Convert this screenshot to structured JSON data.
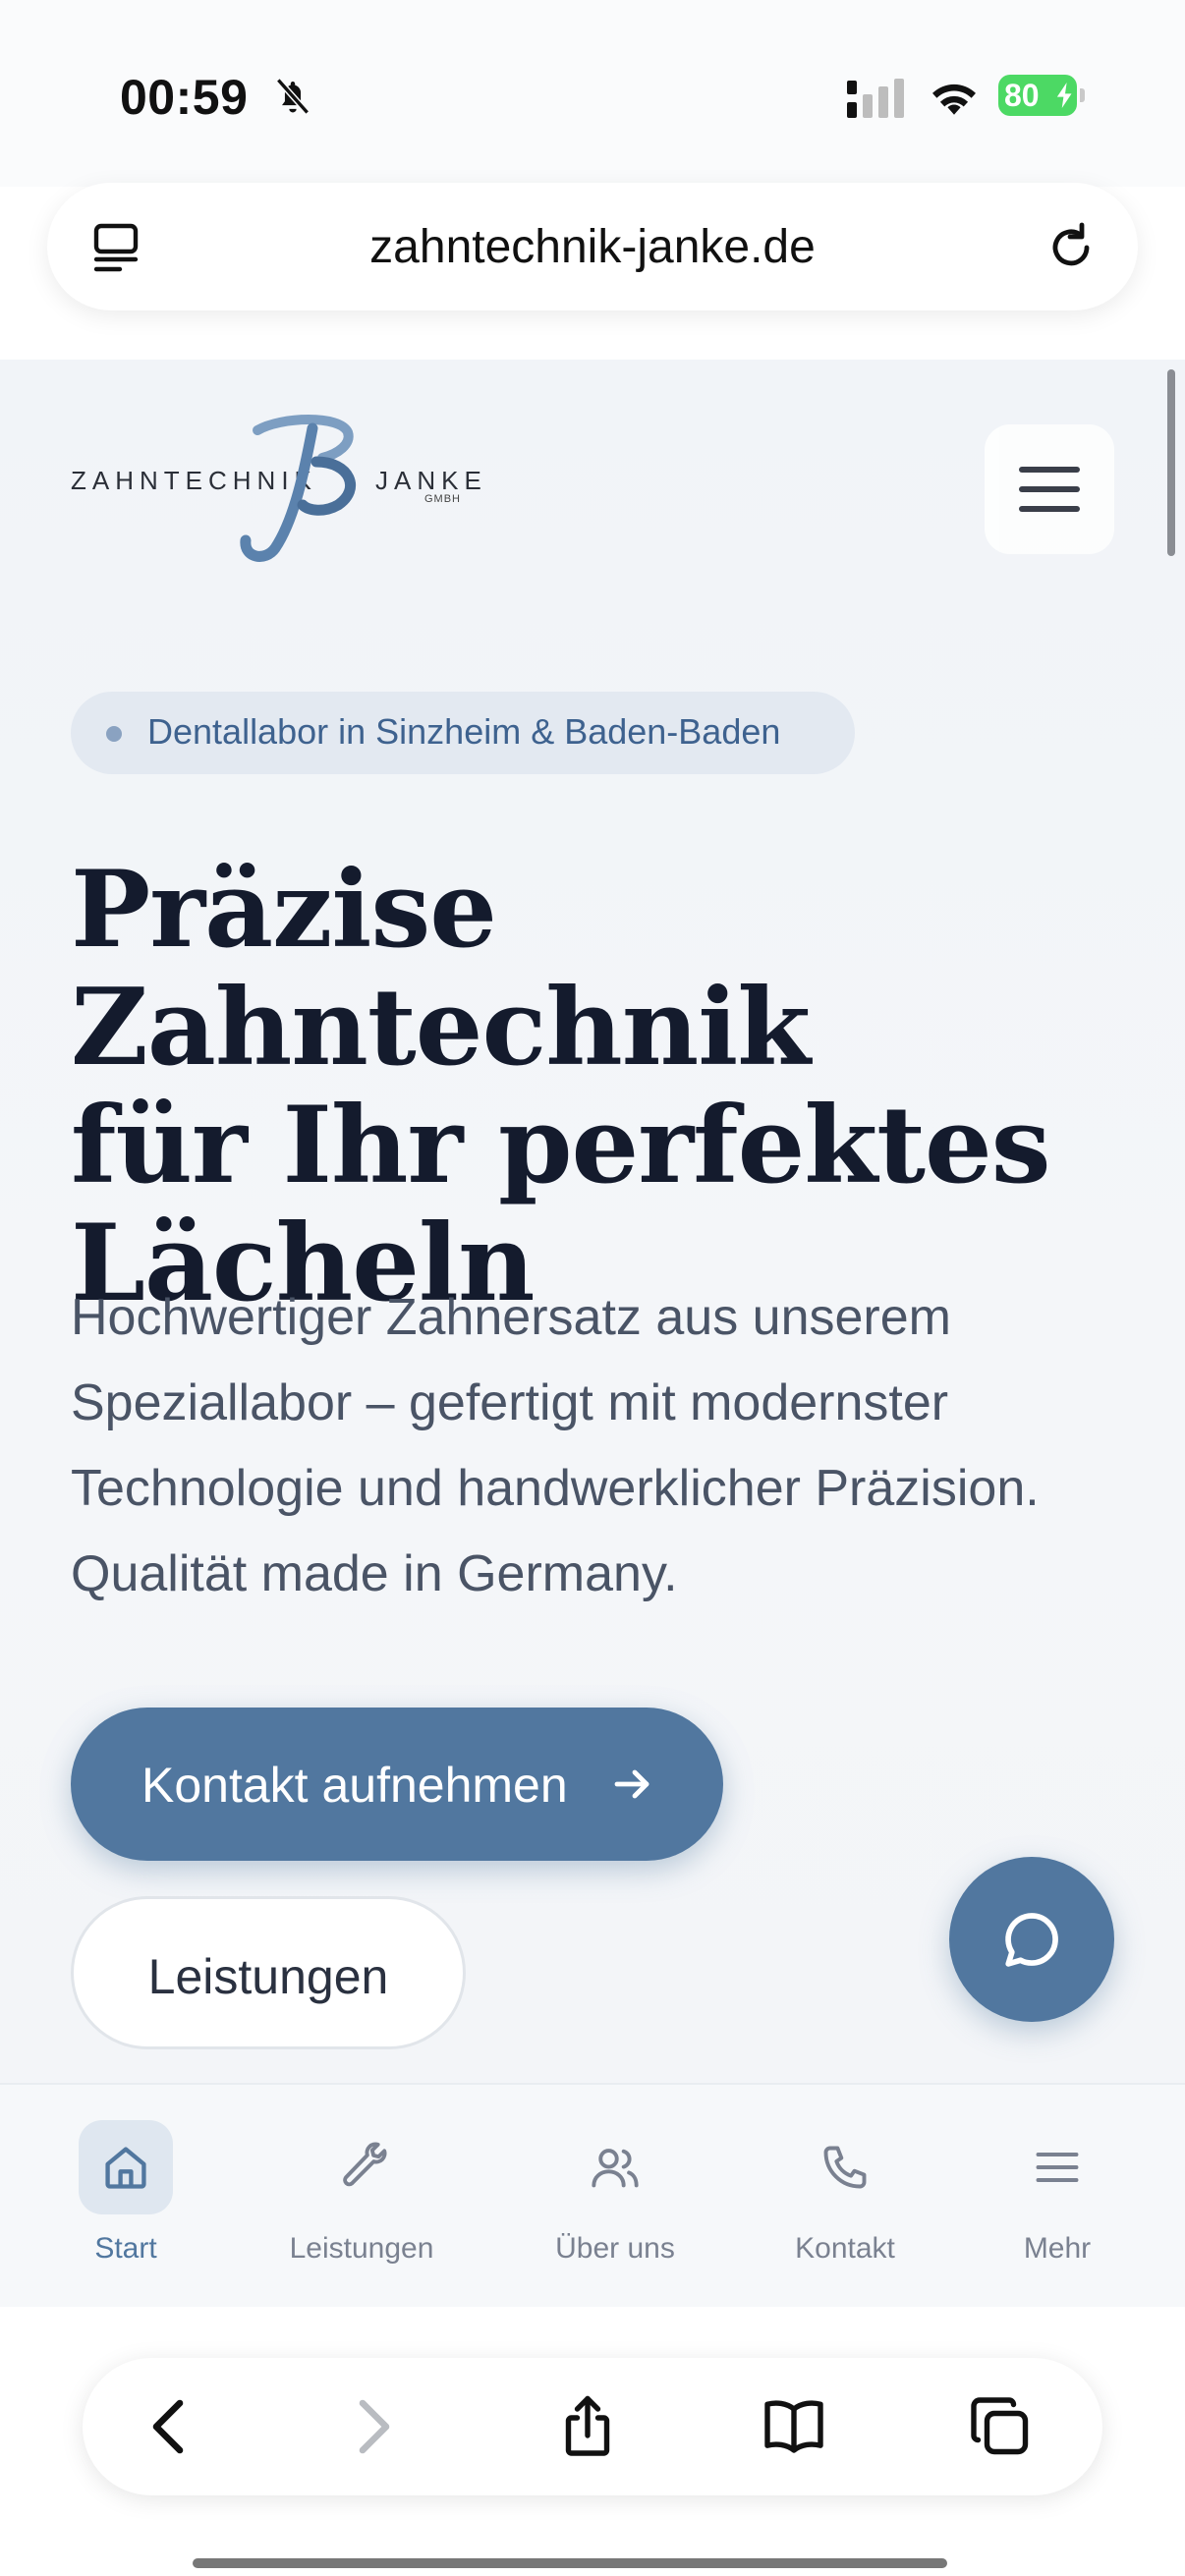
{
  "status_bar": {
    "time": "00:59",
    "battery": "80",
    "icons": [
      "bell-slash-icon",
      "cellular-signal-icon",
      "wifi-icon",
      "battery-charging-icon"
    ]
  },
  "browser": {
    "url": "zahntechnik-janke.de",
    "tabs_icon": "tab-overview-icon",
    "reload_icon": "reload-icon"
  },
  "header": {
    "logo": {
      "left_text": "ZAHNTECHNIK",
      "right_text": "JANKE",
      "suffix": "GMBH"
    },
    "menu_icon": "hamburger-icon"
  },
  "hero": {
    "badge": "Dentallabor in Sinzheim & Baden-Baden",
    "title_line1": "Präzise Zahntechnik",
    "title_line2": "für Ihr perfektes",
    "title_line3": "Lächeln",
    "description": "Hochwertiger Zahnersatz aus unserem Speziallabor – gefertigt mit modernster Technologie und handwerklicher Präzision. Qualität made in Germany.",
    "primary_button": "Kontakt aufnehmen",
    "secondary_button": "Leistungen"
  },
  "chat": {
    "icon": "chat-bubble-icon"
  },
  "bottom_nav": {
    "items": [
      {
        "label": "Start",
        "icon": "home-icon",
        "active": true
      },
      {
        "label": "Leistungen",
        "icon": "wrench-icon",
        "active": false
      },
      {
        "label": "Über uns",
        "icon": "users-icon",
        "active": false
      },
      {
        "label": "Kontakt",
        "icon": "phone-icon",
        "active": false
      },
      {
        "label": "Mehr",
        "icon": "menu-icon",
        "active": false
      }
    ]
  },
  "safari_toolbar": {
    "icons": [
      "back-icon",
      "forward-icon",
      "share-icon",
      "bookmarks-icon",
      "tabs-icon"
    ]
  },
  "colors": {
    "accent": "#51779f",
    "text_dark": "#141b2d",
    "text_muted": "#4a5466",
    "badge_bg": "#e3e9f1",
    "badge_text": "#3e628f",
    "battery": "#4cd964"
  }
}
